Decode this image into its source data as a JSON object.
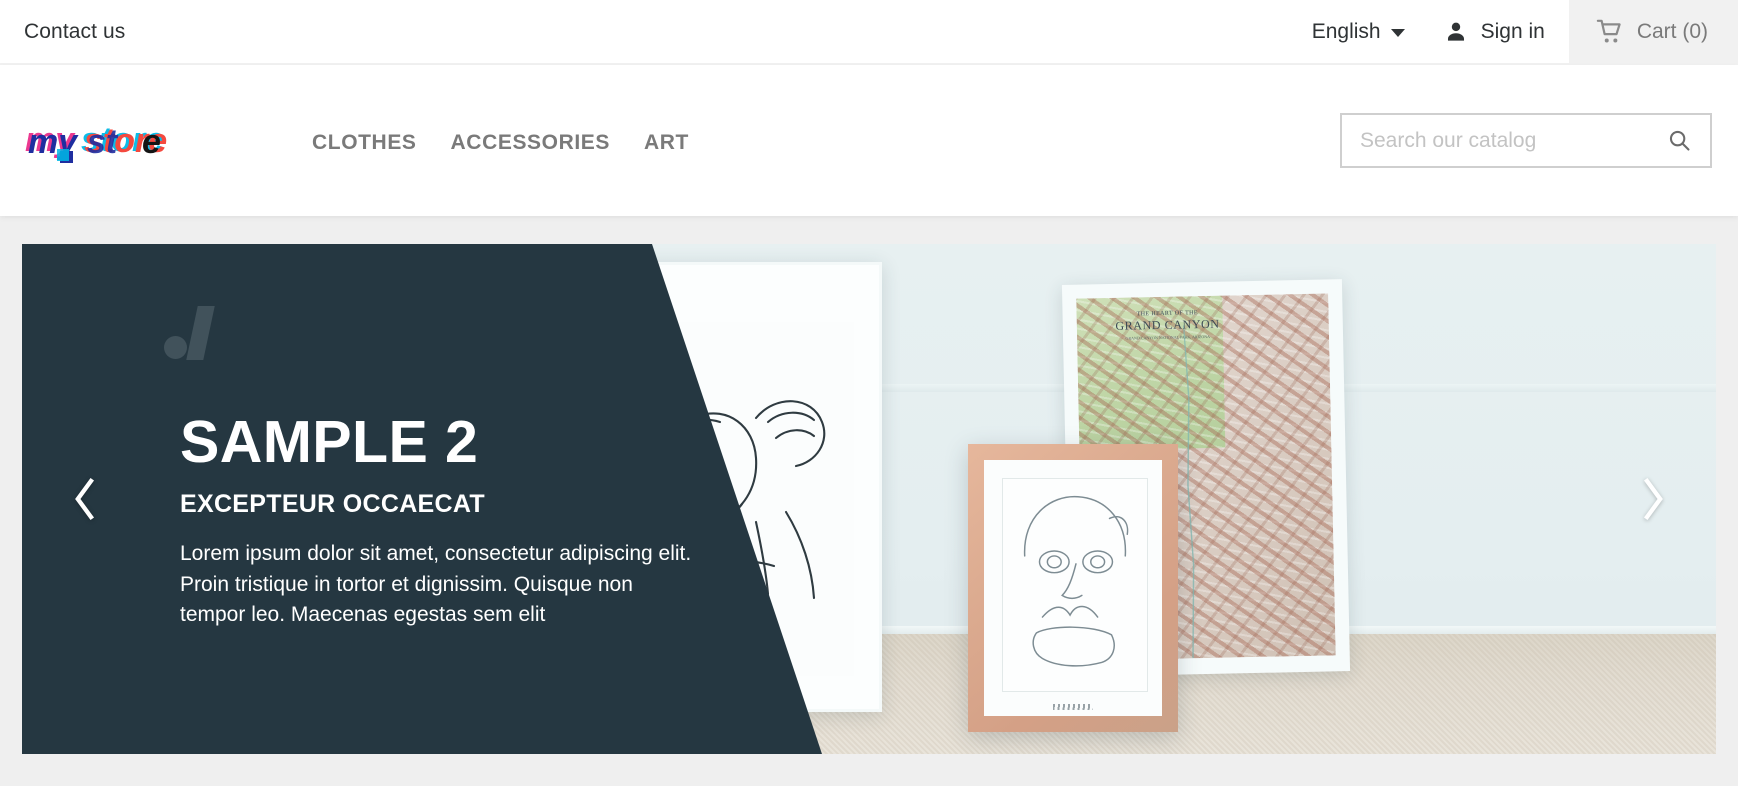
{
  "topbar": {
    "contact_label": "Contact us",
    "language": {
      "selected": "English",
      "icon": "chevron-down-icon"
    },
    "signin": {
      "label": "Sign in",
      "icon": "person-icon"
    },
    "cart": {
      "label": "Cart (0)",
      "count": 0,
      "icon": "shopping-cart-icon",
      "background": "#f1f1f1"
    }
  },
  "header": {
    "logo": {
      "text": "my store",
      "word1": "my",
      "word2": "store",
      "colors": [
        "#1f2ea0",
        "#ea2e8b",
        "#f4493f",
        "#00b9e6",
        "#2b2b6e"
      ]
    },
    "nav": [
      {
        "label": "CLOTHES"
      },
      {
        "label": "ACCESSORIES"
      },
      {
        "label": "ART"
      }
    ],
    "search": {
      "placeholder": "Search our catalog",
      "value": "",
      "icon": "search-icon"
    }
  },
  "carousel": {
    "slide": {
      "title": "SAMPLE 2",
      "subtitle": "EXCEPTEUR OCCAECAT",
      "description": "Lorem ipsum dolor sit amet, consectetur adipiscing elit. Proin tristique in tortor et dignissim. Quisque non tempor leo. Maecenas egestas sem elit"
    },
    "prev_icon": "chevron-left-icon",
    "next_icon": "chevron-right-icon",
    "panel_color": "#253741",
    "page_background": "#efefef",
    "artwork": {
      "map_poster": {
        "overline": "THE HEART OF THE",
        "title": "GRAND CANYON",
        "subtitle": "GRAND CANYON NATIONAL PARK, ARIZONA"
      }
    }
  }
}
